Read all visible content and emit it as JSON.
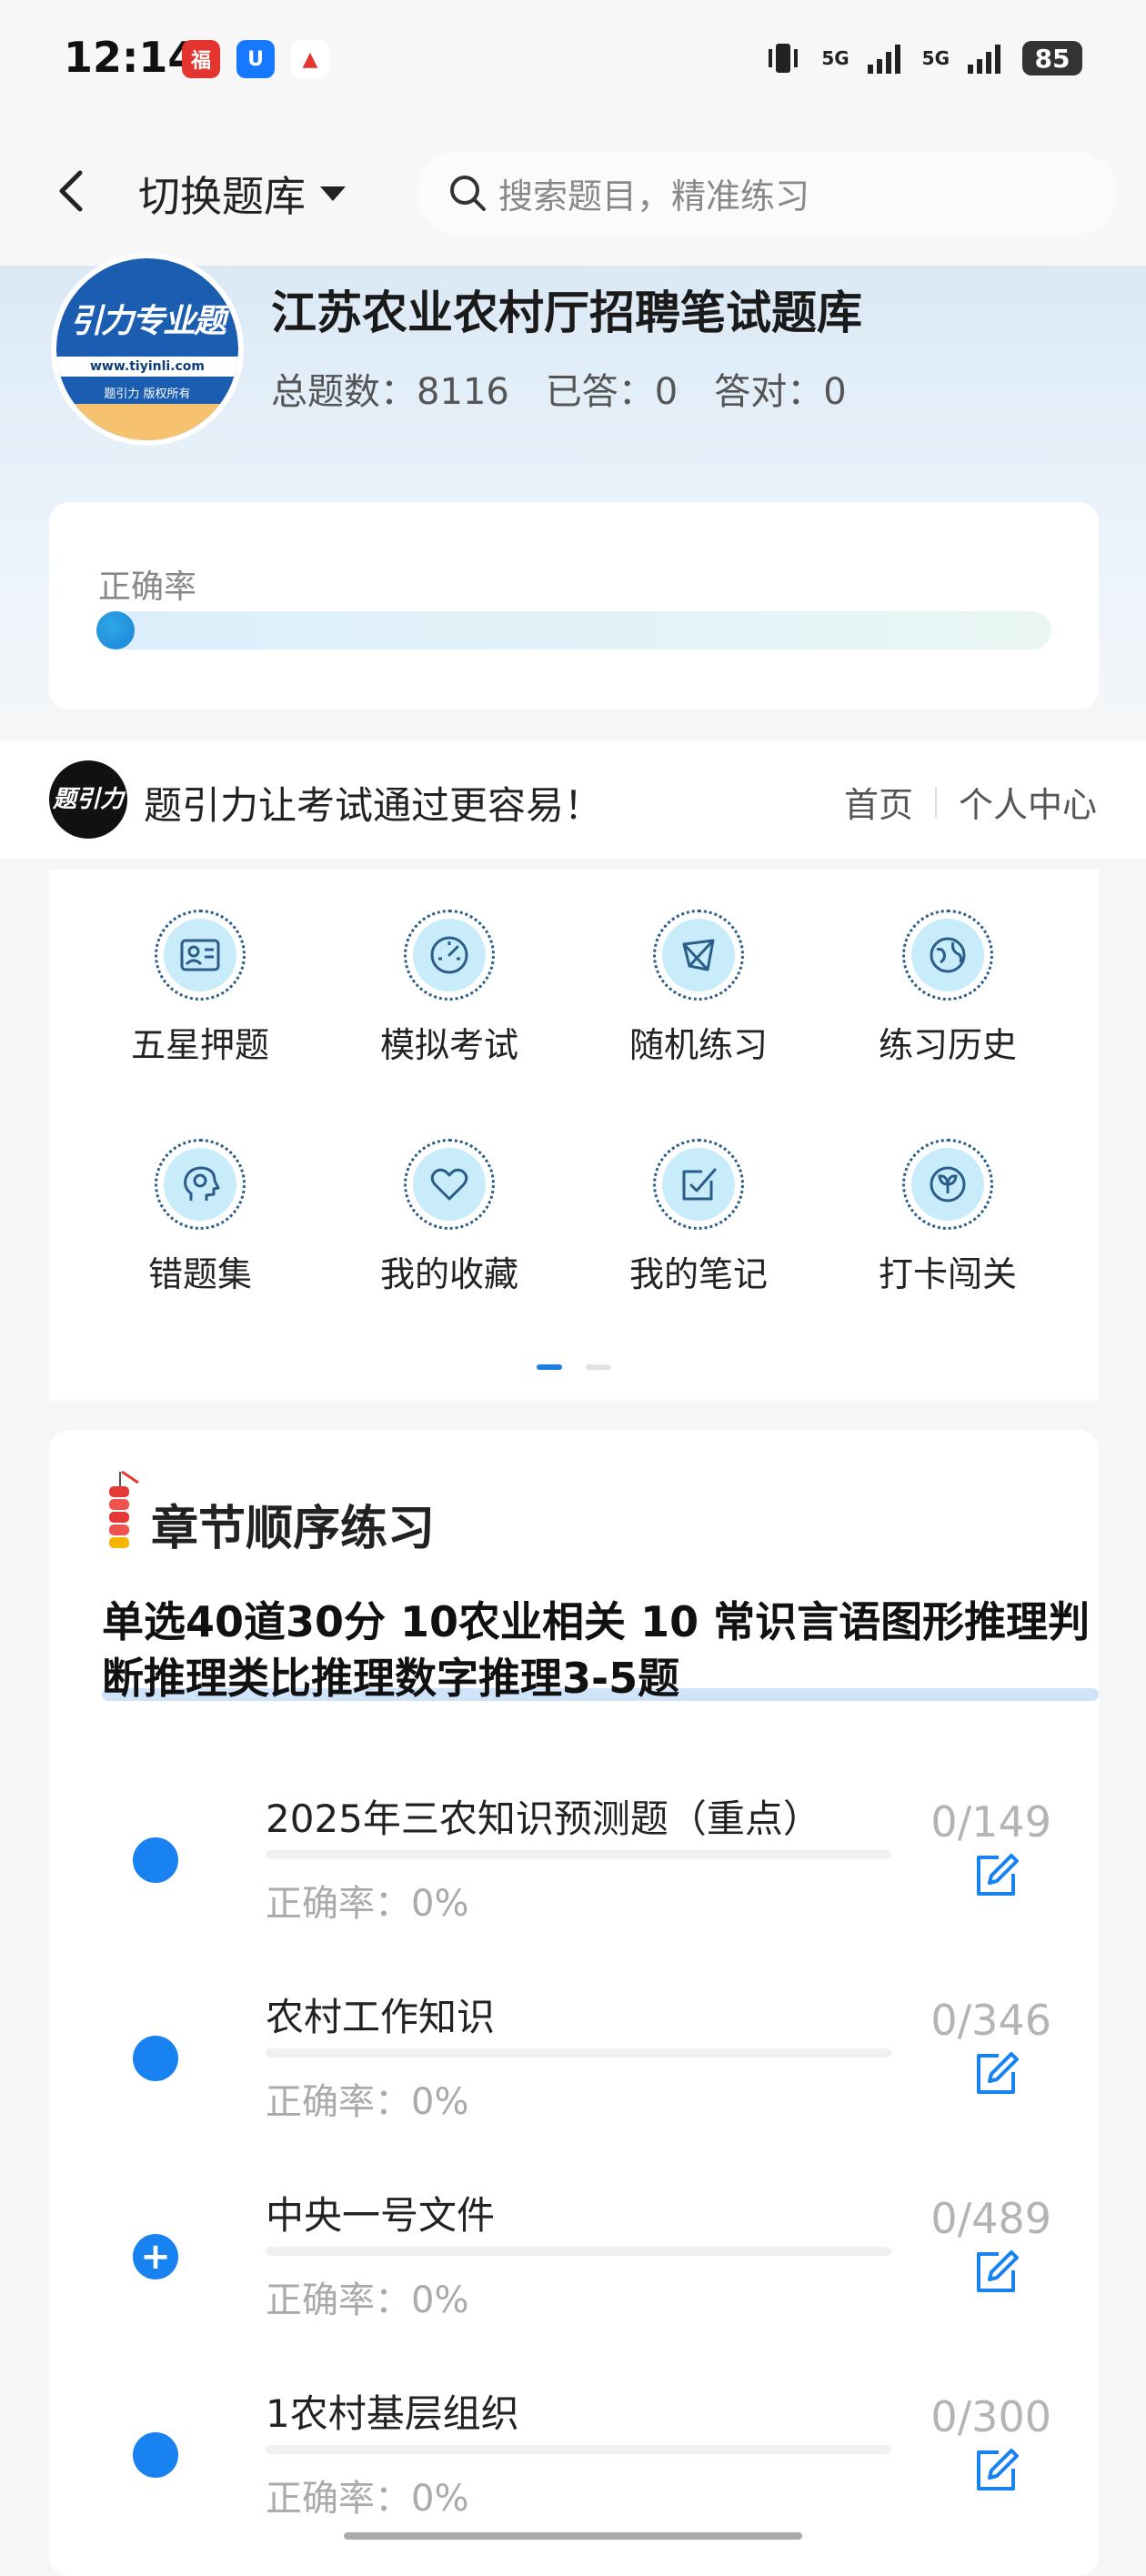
{
  "status": {
    "time": "12:14",
    "signal1": "5G",
    "signal2": "5G",
    "battery": "85"
  },
  "nav": {
    "switch_label": "切换题库",
    "search_placeholder": "搜索题目，精准练习"
  },
  "bank": {
    "logo_text": "引力专业题",
    "logo_url": "www.tiyinli.com",
    "logo_copyright": "题引力 版权所有",
    "title": "江苏农业农村厅招聘笔试题库",
    "total": "总题数：8116",
    "answered": "已答：0",
    "correct": "答对：0"
  },
  "accuracy": {
    "label": "正确率",
    "value": 0
  },
  "banner": {
    "logo_text": "题引力",
    "slogan": "题引力让考试通过更容易！",
    "home": "首页",
    "personal": "个人中心"
  },
  "functions": [
    {
      "label": "五星押题",
      "icon": "id-card-icon"
    },
    {
      "label": "模拟考试",
      "icon": "gauge-icon"
    },
    {
      "label": "随机练习",
      "icon": "random-icon"
    },
    {
      "label": "练习历史",
      "icon": "globe-icon"
    },
    {
      "label": "错题集",
      "icon": "head-icon"
    },
    {
      "label": "我的收藏",
      "icon": "heart-icon"
    },
    {
      "label": "我的笔记",
      "icon": "note-check-icon"
    },
    {
      "label": "打卡闯关",
      "icon": "sprout-icon"
    }
  ],
  "chapter": {
    "title": "章节顺序练习",
    "description": "单选40道30分 10农业相关 10 常识言语图形推理判断推理类比推理数字推理3-5题",
    "items": [
      {
        "name": "2025年三农知识预测题（重点）",
        "rate": "正确率：0%",
        "count": "0/149",
        "expand": ""
      },
      {
        "name": "农村工作知识",
        "rate": "正确率：0%",
        "count": "0/346",
        "expand": ""
      },
      {
        "name": "中央一号文件",
        "rate": "正确率：0%",
        "count": "0/489",
        "expand": "+"
      },
      {
        "name": "1农村基层组织",
        "rate": "正确率：0%",
        "count": "0/300",
        "expand": ""
      }
    ]
  },
  "colors": {
    "accent": "#1782f0",
    "icon_bg": "#c9ecfa",
    "icon_stroke": "#2a5d8a"
  }
}
